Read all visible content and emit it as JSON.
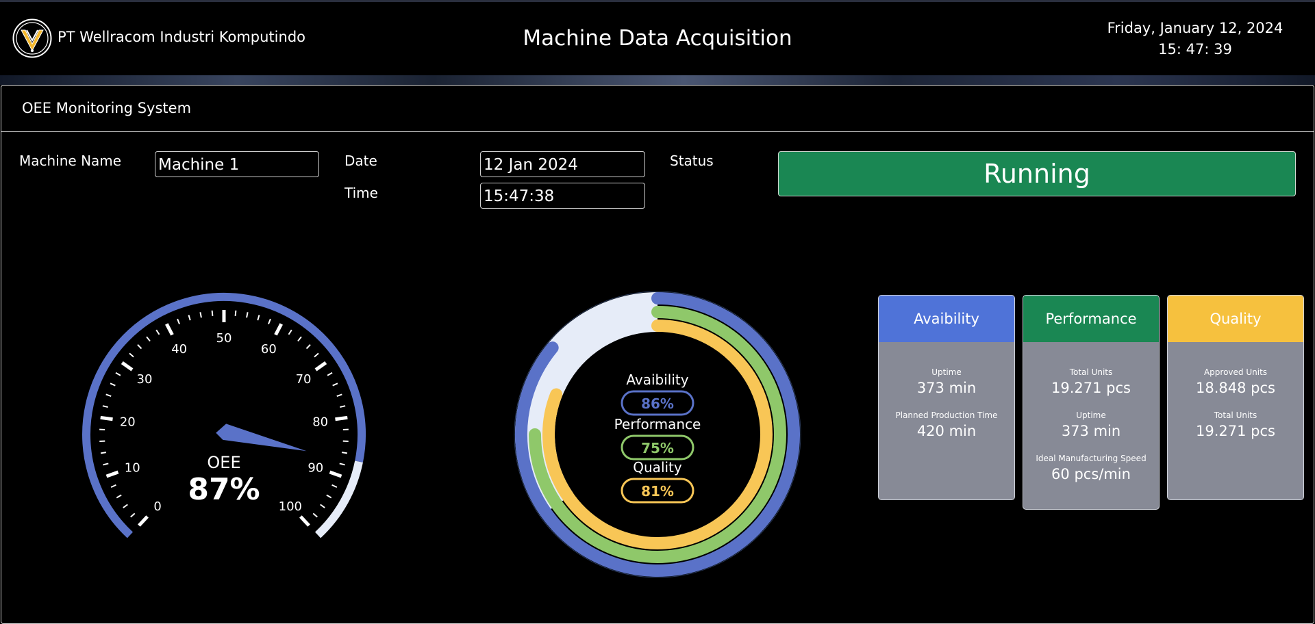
{
  "header": {
    "company": "PT Wellracom Industri Komputindo",
    "title": "Machine Data Acquisition",
    "date": "Friday, January 12, 2024",
    "time": "15: 47: 39"
  },
  "panel": {
    "title": "OEE Monitoring System"
  },
  "form": {
    "machine_name_label": "Machine Name",
    "machine_name_value": "Machine 1",
    "date_label": "Date",
    "date_value": "12 Jan 2024",
    "time_label": "Time",
    "time_value": "15:47:38",
    "status_label": "Status",
    "status_value": "Running"
  },
  "gauge": {
    "label": "OEE",
    "value_text": "87%",
    "value": 87,
    "min": 0,
    "max": 100,
    "tick_labels": [
      "0",
      "10",
      "20",
      "30",
      "40",
      "50",
      "60",
      "70",
      "80",
      "90",
      "100"
    ],
    "arc_color": "#5a72c8",
    "remainder_color": "#e6ecf8"
  },
  "rings": {
    "items": [
      {
        "label": "Avaibility",
        "value_text": "86%",
        "value": 86,
        "color": "#5a72c8"
      },
      {
        "label": "Performance",
        "value_text": "75%",
        "value": 75,
        "color": "#8fc86a"
      },
      {
        "label": "Quality",
        "value_text": "81%",
        "value": 81,
        "color": "#f8c656"
      }
    ],
    "track_color": "#e6ecf8"
  },
  "cards": [
    {
      "title": "Avaibility",
      "color": "#4f73d8",
      "metrics": [
        {
          "caption": "Uptime",
          "value": "373 min"
        },
        {
          "caption": "Planned Production Time",
          "value": "420 min"
        }
      ]
    },
    {
      "title": "Performance",
      "color": "#1a8753",
      "metrics": [
        {
          "caption": "Total Units",
          "value": "19.271 pcs"
        },
        {
          "caption": "Uptime",
          "value": "373 min"
        },
        {
          "caption": "Ideal Manufacturing Speed",
          "value": "60 pcs/min"
        }
      ]
    },
    {
      "title": "Quality",
      "color": "#f6c13e",
      "metrics": [
        {
          "caption": "Approved Units",
          "value": "18.848 pcs"
        },
        {
          "caption": "Total Units",
          "value": "19.271 pcs"
        }
      ]
    }
  ]
}
